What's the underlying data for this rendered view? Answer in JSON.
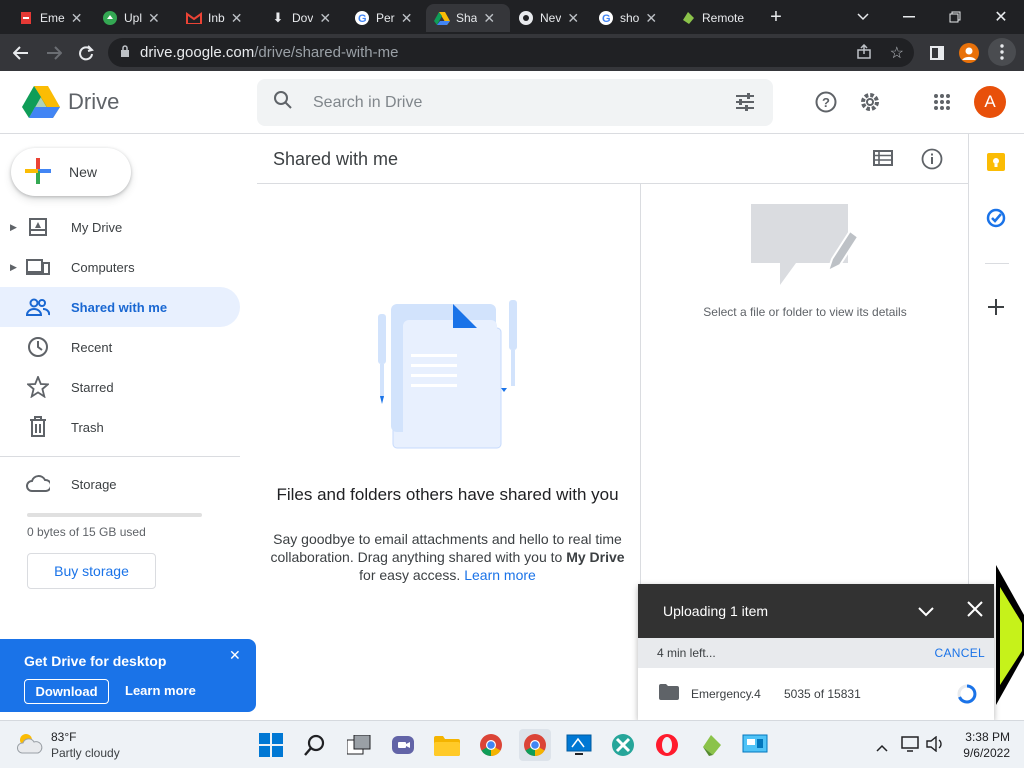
{
  "browser": {
    "tabs": [
      {
        "title": "Eme",
        "icon": "pdf-icon",
        "active": false
      },
      {
        "title": "Upl",
        "icon": "cloud-icon",
        "active": false
      },
      {
        "title": "Inb",
        "icon": "gmail-icon",
        "active": false
      },
      {
        "title": "Dov",
        "icon": "download-icon",
        "active": false
      },
      {
        "title": "Per",
        "icon": "google-icon",
        "active": false
      },
      {
        "title": "Sha",
        "icon": "drive-icon",
        "active": true
      },
      {
        "title": "Nev",
        "icon": "chrome-icon",
        "active": false
      },
      {
        "title": "sho",
        "icon": "google-icon",
        "active": false
      },
      {
        "title": "Remote",
        "icon": "remote-icon",
        "active": false
      }
    ],
    "url_host": "drive.google.com",
    "url_path": "/drive/shared-with-me",
    "profile_initial": ""
  },
  "header": {
    "app_name": "Drive",
    "search_placeholder": "Search in Drive",
    "account_initial": "A"
  },
  "sidebar": {
    "new_label": "New",
    "items": [
      {
        "label": "My Drive",
        "icon": "my-drive-icon",
        "expandable": true,
        "active": false
      },
      {
        "label": "Computers",
        "icon": "computers-icon",
        "expandable": true,
        "active": false
      },
      {
        "label": "Shared with me",
        "icon": "shared-icon",
        "expandable": false,
        "active": true
      },
      {
        "label": "Recent",
        "icon": "clock-icon",
        "expandable": false,
        "active": false
      },
      {
        "label": "Starred",
        "icon": "star-icon",
        "expandable": false,
        "active": false
      },
      {
        "label": "Trash",
        "icon": "trash-icon",
        "expandable": false,
        "active": false
      }
    ],
    "storage_label": "Storage",
    "storage_used": "0 bytes of 15 GB used",
    "storage_fraction": 0,
    "buy_storage": "Buy storage",
    "promo": {
      "title": "Get Drive for desktop",
      "download": "Download",
      "learn_more": "Learn more"
    }
  },
  "main": {
    "title": "Shared with me",
    "empty_title": "Files and folders others have shared with you",
    "empty_desc_1": "Say goodbye to email attachments and hello to real time collaboration. Drag anything shared with you to",
    "empty_desc_bold": "My Drive",
    "empty_desc_2": "for easy access.",
    "empty_desc_link": "Learn more",
    "details_hint": "Select a file or folder to view its details"
  },
  "upload": {
    "title": "Uploading 1 item",
    "time_left": "4 min left...",
    "cancel": "CANCEL",
    "item_name": "Emergency.4",
    "item_progress": "5035 of 15831"
  },
  "taskbar": {
    "temperature": "83°F",
    "weather": "Partly cloudy",
    "time": "3:38 PM",
    "date": "9/6/2022"
  },
  "colors": {
    "accent": "#1a73e8",
    "active_bg": "#e8f0fe",
    "avatar": "#e8710a",
    "green_arrow": "#c6f21a"
  }
}
